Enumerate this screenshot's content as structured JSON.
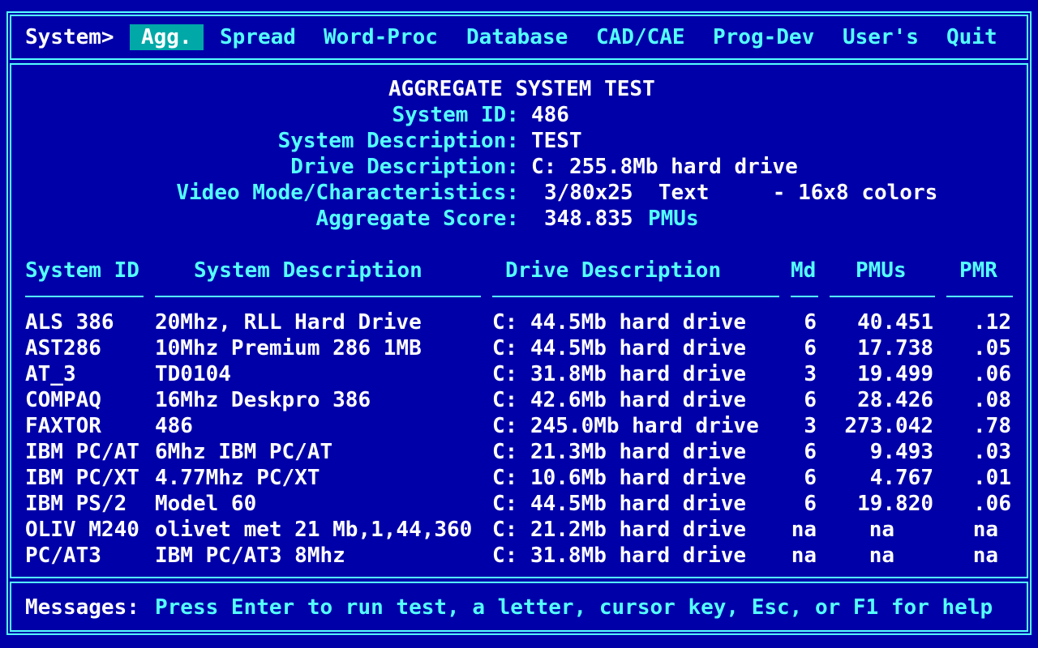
{
  "menu": {
    "prompt": "System>",
    "items": [
      {
        "label": "Agg.",
        "selected": true
      },
      {
        "label": "Spread"
      },
      {
        "label": "Word-Proc"
      },
      {
        "label": "Database"
      },
      {
        "label": "CAD/CAE"
      },
      {
        "label": "Prog-Dev"
      },
      {
        "label": "User's"
      },
      {
        "label": "Quit"
      }
    ]
  },
  "summary": {
    "title": "AGGREGATE SYSTEM TEST",
    "system_id_label": "System ID:",
    "system_id": "486",
    "system_desc_label": "System Description:",
    "system_desc": "TEST",
    "drive_desc_label": "Drive Description:",
    "drive_desc": "C: 255.8Mb hard drive",
    "video_label": "Video Mode/Characteristics:",
    "video_value": "3/80x25  Text     - 16x8 colors",
    "score_label": "Aggregate Score:",
    "score_value": "348.835",
    "score_unit": "PMUs"
  },
  "table": {
    "headers": [
      "System ID",
      "System Description",
      "Drive Description",
      "Md",
      "PMUs",
      "PMR"
    ],
    "rows": [
      [
        "ALS 386",
        "20Mhz, RLL Hard Drive",
        "C: 44.5Mb hard drive",
        "6",
        "40.451",
        ".12"
      ],
      [
        "AST286",
        "10Mhz Premium 286 1MB",
        "C: 44.5Mb hard drive",
        "6",
        "17.738",
        ".05"
      ],
      [
        "AT_3",
        "TD0104",
        "C: 31.8Mb hard drive",
        "3",
        "19.499",
        ".06"
      ],
      [
        "COMPAQ",
        "16Mhz Deskpro 386",
        "C: 42.6Mb hard drive",
        "6",
        "28.426",
        ".08"
      ],
      [
        "FAXTOR",
        "486",
        "C: 245.0Mb hard drive",
        "3",
        "273.042",
        ".78"
      ],
      [
        "IBM PC/AT",
        "6Mhz IBM PC/AT",
        "C: 21.3Mb hard drive",
        "6",
        "9.493",
        ".03"
      ],
      [
        "IBM PC/XT",
        "4.77Mhz PC/XT",
        "C: 10.6Mb hard drive",
        "6",
        "4.767",
        ".01"
      ],
      [
        "IBM PS/2",
        "Model 60",
        "C: 44.5Mb hard drive",
        "6",
        "19.820",
        ".06"
      ],
      [
        "OLIV M240",
        "olivet met 21 Mb,1,44,360",
        "C: 21.2Mb hard drive",
        "na",
        "na",
        "na"
      ],
      [
        "PC/AT3",
        "IBM PC/AT3 8Mhz",
        "C: 31.8Mb hard drive",
        "na",
        "na",
        "na"
      ]
    ]
  },
  "messages": {
    "label": "Messages:",
    "text": "Press Enter to run test, a letter, cursor key, Esc, or F1 for help"
  },
  "colors": {
    "background": "#0000a8",
    "accent": "#55ffff",
    "highlight": "#00a8a8",
    "text": "#ffffff"
  }
}
